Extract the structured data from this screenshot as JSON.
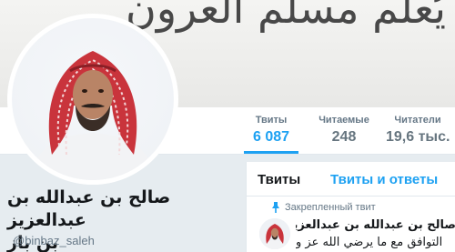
{
  "banner": {
    "text": "يُعلّم مسلم العرون"
  },
  "stats": [
    {
      "label": "Твиты",
      "value": "6 087",
      "active": true
    },
    {
      "label": "Читаемые",
      "value": "248",
      "active": false
    },
    {
      "label": "Читатели",
      "value": "19,6 тыс.",
      "active": false
    }
  ],
  "profile": {
    "name_line1": "صالح بن عبدالله بن عبدالعزيز",
    "name_line2": "بن باز",
    "handle": "@binbaz_saleh"
  },
  "timeline": {
    "tabs": [
      "Твиты",
      "Твиты и ответы"
    ],
    "pinned_label": "Закрепленный твит",
    "tweet_author": "صالح بن عبدالله بن عبدالعزيز بن باز",
    "tweet_body": "التوافق مع ما يرضي الله عز و"
  },
  "colors": {
    "accent": "#1da1f2",
    "text": "#14171a",
    "muted": "#657786"
  },
  "icons": {
    "pin": "pin-icon"
  }
}
